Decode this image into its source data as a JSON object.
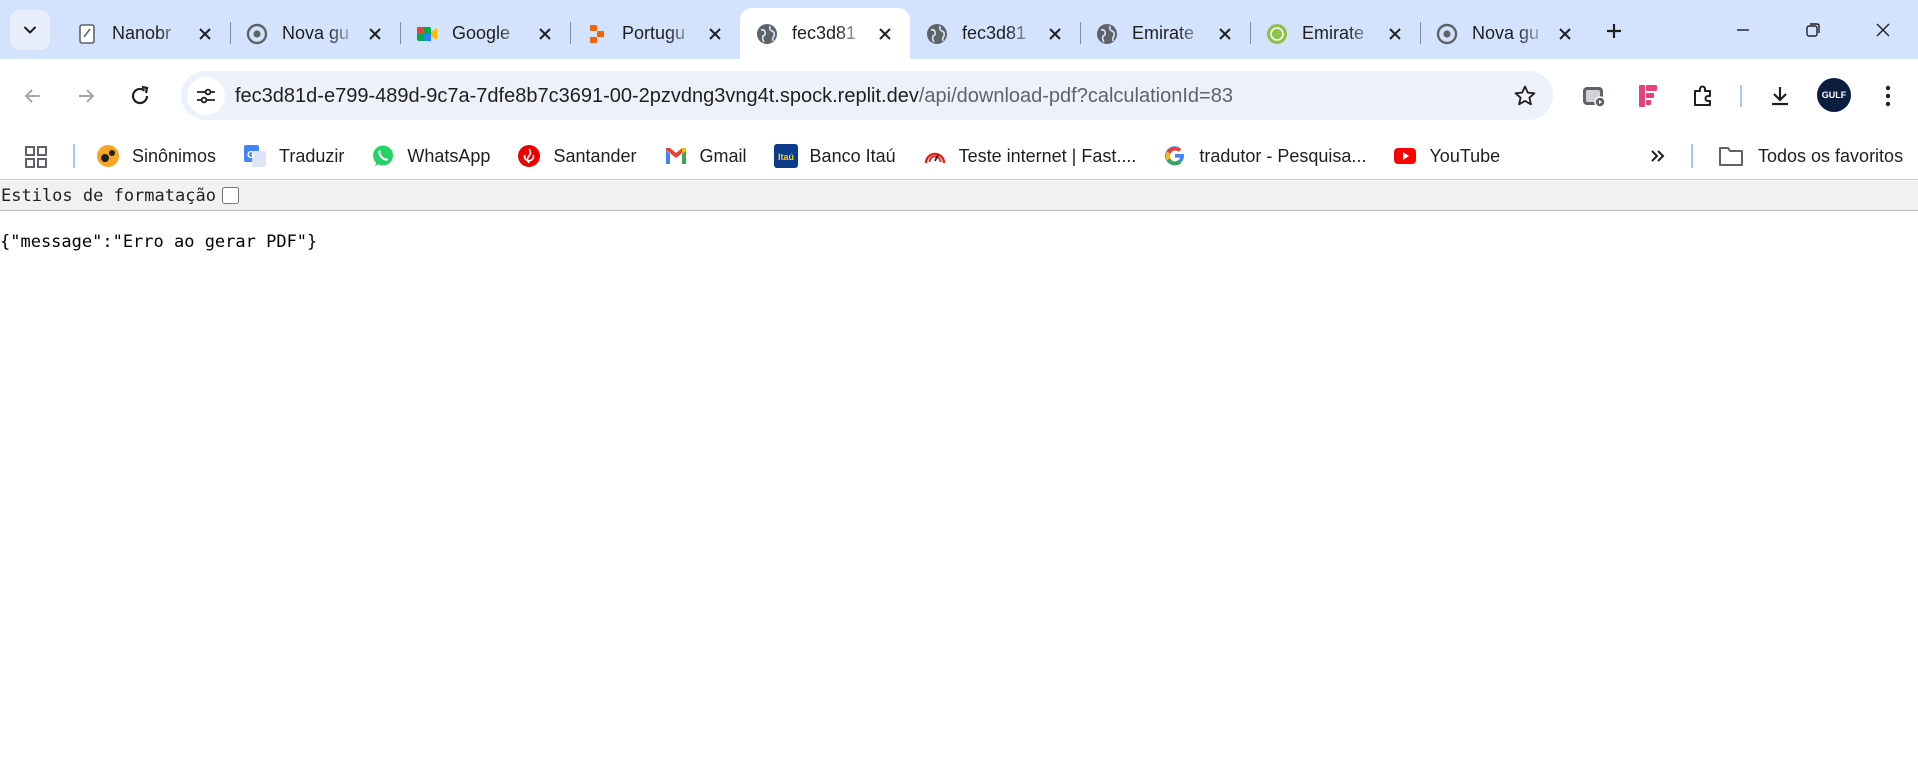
{
  "tabs": [
    {
      "title": "Nanobr",
      "icon": "notepad-icon",
      "active": false
    },
    {
      "title": "Nova gu",
      "icon": "chrome-icon",
      "active": false
    },
    {
      "title": "Google",
      "icon": "google-meet-icon",
      "active": false
    },
    {
      "title": "Portugu",
      "icon": "replit-icon",
      "active": false
    },
    {
      "title": "fec3d81",
      "icon": "globe-icon",
      "active": true
    },
    {
      "title": "fec3d81",
      "icon": "globe-icon",
      "active": false
    },
    {
      "title": "Emirate",
      "icon": "globe-icon",
      "active": false
    },
    {
      "title": "Emirate",
      "icon": "emirates-icon",
      "active": false
    },
    {
      "title": "Nova gu",
      "icon": "chrome-icon",
      "active": false
    }
  ],
  "address_bar": {
    "host": "fec3d81d-e799-489d-9c7a-7dfe8b7c3691-00-2pzvdng3vng4t.spock.replit.dev",
    "path": "/api/download-pdf?calculationId=83"
  },
  "profile": {
    "avatar_text": "GULF"
  },
  "bookmarks": [
    {
      "label": "Sinônimos",
      "icon": "sinonimos-icon"
    },
    {
      "label": "Traduzir",
      "icon": "google-translate-icon"
    },
    {
      "label": "WhatsApp",
      "icon": "whatsapp-icon"
    },
    {
      "label": "Santander",
      "icon": "santander-icon"
    },
    {
      "label": "Gmail",
      "icon": "gmail-icon"
    },
    {
      "label": "Banco Itaú",
      "icon": "itau-icon"
    },
    {
      "label": "Teste internet | Fast....",
      "icon": "speedometer-icon"
    },
    {
      "label": "tradutor - Pesquisa...",
      "icon": "google-icon"
    },
    {
      "label": "YouTube",
      "icon": "youtube-icon"
    }
  ],
  "all_bookmarks_label": "Todos os favoritos",
  "page": {
    "format_label": "Estilos de formatação",
    "json_text": "{\"message\":\"Erro ao gerar PDF\"}"
  },
  "colors": {
    "tab_strip": "#d3e3fd",
    "omnibox": "#edf2fa",
    "accent": "#a8c7fa"
  }
}
